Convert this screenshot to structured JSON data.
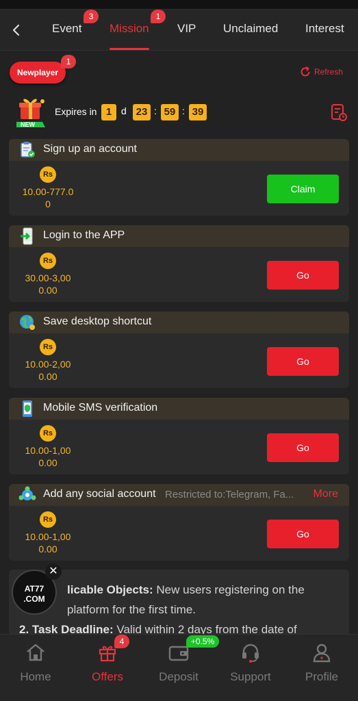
{
  "tabs": [
    {
      "label": "Event",
      "badge": "3"
    },
    {
      "label": "Mission",
      "badge": "1"
    },
    {
      "label": "VIP"
    },
    {
      "label": "Unclaimed"
    },
    {
      "label": "Interest"
    }
  ],
  "subheader": {
    "newplayer_label": "Newplayer",
    "newplayer_badge": "1",
    "refresh_label": "Refresh"
  },
  "expires": {
    "gift_label": "NEW",
    "label": "Expires in",
    "days": "1",
    "day_unit": "d",
    "hours": "23",
    "minutes": "59",
    "seconds": "39",
    "sep": ":"
  },
  "currency_symbol": "Rs",
  "missions": [
    {
      "title": "Sign up an account",
      "reward_line1": "10.00-777.0",
      "reward_line2": "0",
      "button": "Claim"
    },
    {
      "title": "Login to the APP",
      "reward_line1": "30.00-3,00",
      "reward_line2": "0.00",
      "button": "Go"
    },
    {
      "title": "Save desktop shortcut",
      "reward_line1": "10.00-2,00",
      "reward_line2": "0.00",
      "button": "Go"
    },
    {
      "title": "Mobile SMS verification",
      "reward_line1": "10.00-1,00",
      "reward_line2": "0.00",
      "button": "Go"
    },
    {
      "title": "Add any social account",
      "restriction": "Restricted to:Telegram, Fa...",
      "more": "More",
      "reward_line1": "10.00-1,00",
      "reward_line2": "0.00",
      "button": "Go"
    }
  ],
  "rules": {
    "line1_bold": "licable Objects:",
    "line1_text": " New users registering on the",
    "line2_text": "platform for the first time.",
    "line3_bold": "2. Task Deadline:",
    "line3_text": " Valid within 2 days from the date of"
  },
  "floating": {
    "logo_top": "AT77",
    "logo_bottom": ".COM",
    "close": "✕"
  },
  "bottom_nav": [
    {
      "label": "Home",
      "icon": "home-icon"
    },
    {
      "label": "Offers",
      "icon": "gift-icon",
      "badge": "4"
    },
    {
      "label": "Deposit",
      "icon": "wallet-icon",
      "pill": "+0.5%"
    },
    {
      "label": "Support",
      "icon": "headset-icon"
    },
    {
      "label": "Profile",
      "icon": "user-icon"
    }
  ],
  "colors": {
    "accent": "#e8323c",
    "gold": "#f5b52a",
    "claim": "#17c21d",
    "go": "#e8202c"
  }
}
